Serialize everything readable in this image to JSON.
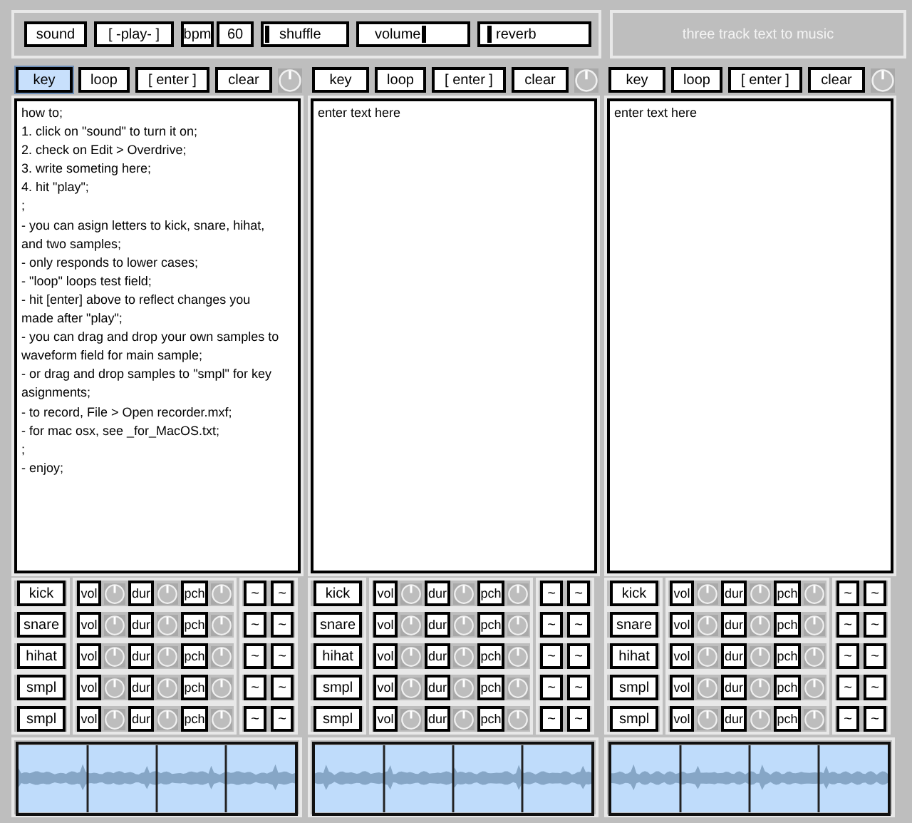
{
  "transport": {
    "sound_button": "sound",
    "play_button": "[ -play- ]",
    "bpm_label": "bpm",
    "bpm_value": "60",
    "sliders": [
      {
        "label": "shuffle",
        "level": 0
      },
      {
        "label": "volume",
        "level": 0.6
      },
      {
        "label": "reverb",
        "level": 0.05
      }
    ]
  },
  "title": "three track text to music",
  "tracks": [
    {
      "buttons": [
        {
          "label": "key",
          "selected": true
        },
        {
          "label": "loop",
          "selected": false
        },
        {
          "label": "[ enter ]",
          "selected": false
        },
        {
          "label": "clear",
          "selected": false
        }
      ],
      "text_lines": [
        "how to;",
        "1. click on \"sound\" to turn it on;",
        "2. check on Edit > Overdrive;",
        "3. write someting here;",
        "4. hit \"play\";",
        ";",
        "- you can asign letters to kick, snare, hihat,",
        "and two samples;",
        "- only responds to lower cases;",
        "- \"loop\" loops test field;",
        "- hit [enter] above to reflect changes you",
        "made after \"play\";",
        "- you can drag and drop your own samples to",
        "waveform field for main sample;",
        "- or drag and drop samples to \"smpl\" for key",
        "asignments;",
        "- to record, File > Open recorder.mxf;",
        "- for mac osx, see _for_MacOS.txt;",
        ";",
        "- enjoy;"
      ],
      "samples": [
        {
          "name": "kick",
          "params": [
            "vol",
            "dur",
            "pch"
          ],
          "tildes": [
            "~",
            "~"
          ]
        },
        {
          "name": "snare",
          "params": [
            "vol",
            "dur",
            "pch"
          ],
          "tildes": [
            "~",
            "~"
          ]
        },
        {
          "name": "hihat",
          "params": [
            "vol",
            "dur",
            "pch"
          ],
          "tildes": [
            "~",
            "~"
          ]
        },
        {
          "name": "smpl",
          "params": [
            "vol",
            "dur",
            "pch"
          ],
          "tildes": [
            "~",
            "~"
          ]
        },
        {
          "name": "smpl",
          "params": [
            "vol",
            "dur",
            "pch"
          ],
          "tildes": [
            "~",
            "~"
          ]
        }
      ]
    },
    {
      "buttons": [
        {
          "label": "key",
          "selected": false
        },
        {
          "label": "loop",
          "selected": false
        },
        {
          "label": "[ enter ]",
          "selected": false
        },
        {
          "label": "clear",
          "selected": false
        }
      ],
      "text_lines": [
        "enter text here"
      ],
      "samples": [
        {
          "name": "kick",
          "params": [
            "vol",
            "dur",
            "pch"
          ],
          "tildes": [
            "~",
            "~"
          ]
        },
        {
          "name": "snare",
          "params": [
            "vol",
            "dur",
            "pch"
          ],
          "tildes": [
            "~",
            "~"
          ]
        },
        {
          "name": "hihat",
          "params": [
            "vol",
            "dur",
            "pch"
          ],
          "tildes": [
            "~",
            "~"
          ]
        },
        {
          "name": "smpl",
          "params": [
            "vol",
            "dur",
            "pch"
          ],
          "tildes": [
            "~",
            "~"
          ]
        },
        {
          "name": "smpl",
          "params": [
            "vol",
            "dur",
            "pch"
          ],
          "tildes": [
            "~",
            "~"
          ]
        }
      ]
    },
    {
      "buttons": [
        {
          "label": "key",
          "selected": false
        },
        {
          "label": "loop",
          "selected": false
        },
        {
          "label": "[ enter ]",
          "selected": false
        },
        {
          "label": "clear",
          "selected": false
        }
      ],
      "text_lines": [
        "enter text here"
      ],
      "samples": [
        {
          "name": "kick",
          "params": [
            "vol",
            "dur",
            "pch"
          ],
          "tildes": [
            "~",
            "~"
          ]
        },
        {
          "name": "snare",
          "params": [
            "vol",
            "dur",
            "pch"
          ],
          "tildes": [
            "~",
            "~"
          ]
        },
        {
          "name": "hihat",
          "params": [
            "vol",
            "dur",
            "pch"
          ],
          "tildes": [
            "~",
            "~"
          ]
        },
        {
          "name": "smpl",
          "params": [
            "vol",
            "dur",
            "pch"
          ],
          "tildes": [
            "~",
            "~"
          ]
        },
        {
          "name": "smpl",
          "params": [
            "vol",
            "dur",
            "pch"
          ],
          "tildes": [
            "~",
            "~"
          ]
        }
      ]
    }
  ]
}
